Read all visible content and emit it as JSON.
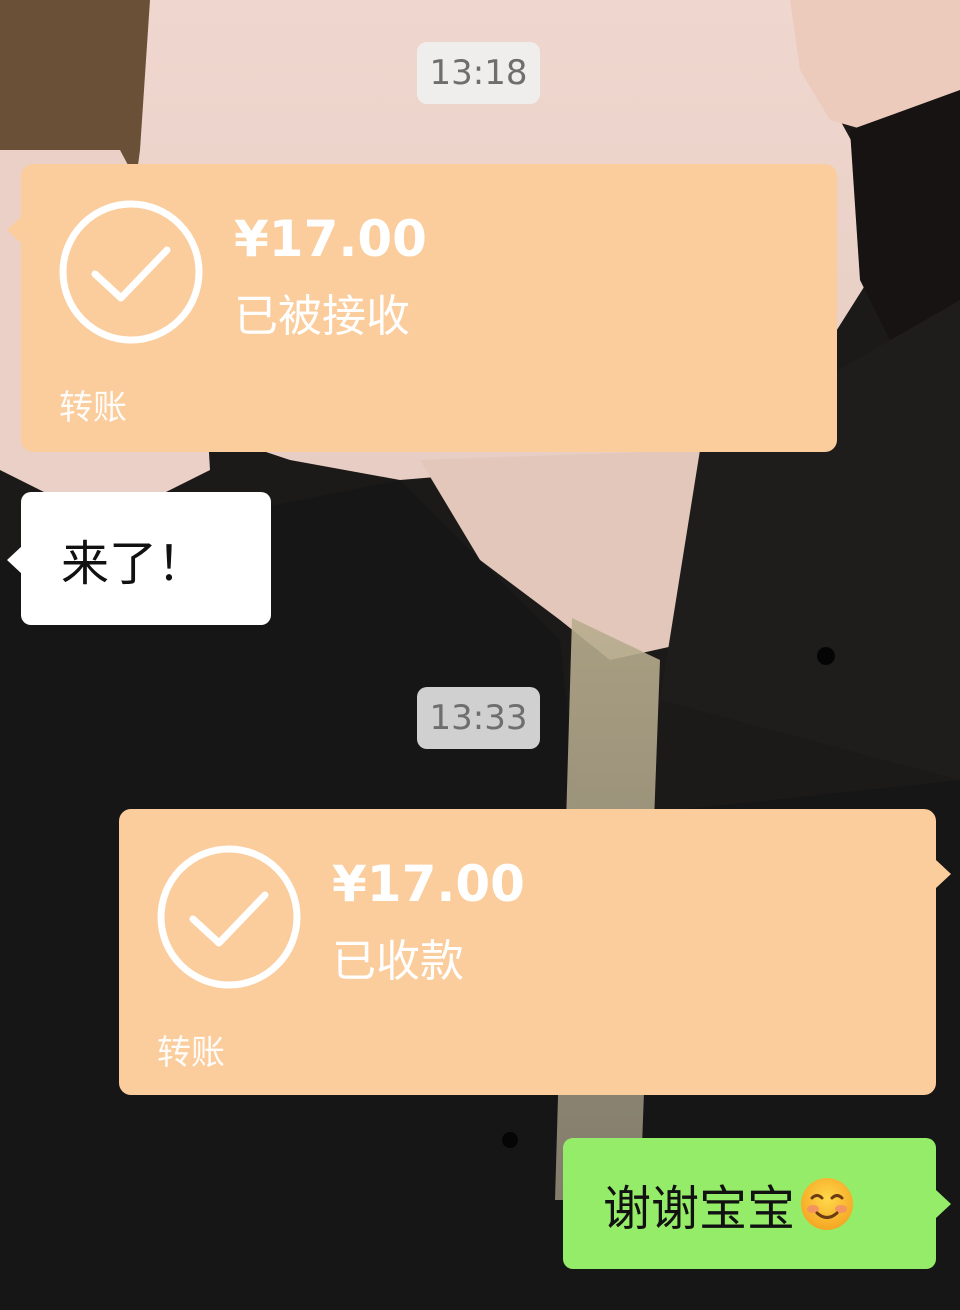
{
  "chat": {
    "messages": [
      {
        "type": "timestamp",
        "text": "13:18"
      },
      {
        "type": "transfer",
        "side": "incoming",
        "amount": "¥17.00",
        "status": "已被接收",
        "label": "转账"
      },
      {
        "type": "text",
        "side": "incoming",
        "text": "来了！"
      },
      {
        "type": "timestamp",
        "text": "13:33"
      },
      {
        "type": "transfer",
        "side": "outgoing",
        "amount": "¥17.00",
        "status": "已收款",
        "label": "转账"
      },
      {
        "type": "text",
        "side": "outgoing",
        "text": "谢谢宝宝",
        "emoji": "smiling-face-emoji"
      }
    ]
  },
  "colors": {
    "transfer_bubble": "#fbcc9c",
    "incoming_bubble": "#ffffff",
    "outgoing_bubble": "#95ec69",
    "timestamp_bg": "#ececec"
  },
  "icons": {
    "transfer_status": "check-circle-icon"
  }
}
